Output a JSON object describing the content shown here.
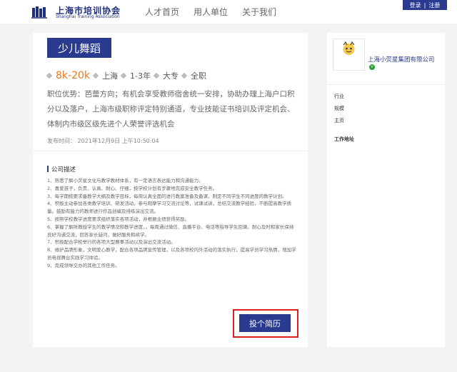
{
  "header": {
    "logo_cn": "上海市培训协会",
    "logo_en": "Shanghai Training Association",
    "nav": [
      "人才首页",
      "用人单位",
      "关于我们"
    ],
    "login": "登录",
    "separator": "|",
    "register": "注册"
  },
  "job": {
    "title": "少儿舞蹈",
    "salary": "8k-20k",
    "city": "上海",
    "experience": "1-3年",
    "education": "大专",
    "type": "全职",
    "advantage": "职位优势：芭蕾方向；有机会享受教师宿舍统一安排，协助办理上海户口积分以及落户，上海市级职称评定特别通道，专业技能证书培训及评定机会、体制内市级区级先进个人荣誉评选机会",
    "publish_time": "发布时间： 2021年12月9日 上午10:50:04"
  },
  "description": {
    "heading": "公司描述",
    "duties": [
      "1、熟悉了解小荧星文化与教学教材体系，有一定语言表达能力和沟通能力。",
      "2、喜爱孩子，负责、认真、耐心、仔细，按学校计划有步骤地完成安全教学任务。",
      "3、每学期按要求备教学大纲及教学目标，每周认真全面的进行教案准备及备课，制定不同学生不同进度的教学计划。",
      "4、积极主动参加各类教学培训、研发活动，参与观摩学习交流讨论等，试课试讲，总结交流教学经验，不断提高教学质量。鼓励有能力的教师进行作品创编及排练演出交流。",
      "5、按照学校教学进度要求组织落实各项活动，并根据业绩获得奖励。",
      "6、掌握了解所教授学生的教学情况和教学进度，，每周通过微信、直播平台、电话等指导学生回课。耐心及时和家长保持良好沟通交流，回答家长疑问，做好服务和续学。",
      "7、积极配合学校举行的各项大型赛事活动以及演出交流活动。",
      "8、维护品牌形象，文明爱心教学，配合各项品牌宣传管理，以及各项校内外活动的落实执行，提高学员学习热情，增加学员电视舞台实践学习体验。",
      "9、完成领导交办的其他工作任务。"
    ]
  },
  "apply_button": "投个简历",
  "company": {
    "name": "上海小荧星集团有限公司",
    "logo_text": "小荧星",
    "logo_subtext": "Shine little Talent",
    "verified_mark": "V",
    "labels": [
      "行业",
      "规模",
      "主页",
      "工作地址"
    ]
  },
  "colors": {
    "brand_blue": "#2a3b8f",
    "salary_orange": "#e8761e",
    "highlight_red": "#d9201a"
  }
}
